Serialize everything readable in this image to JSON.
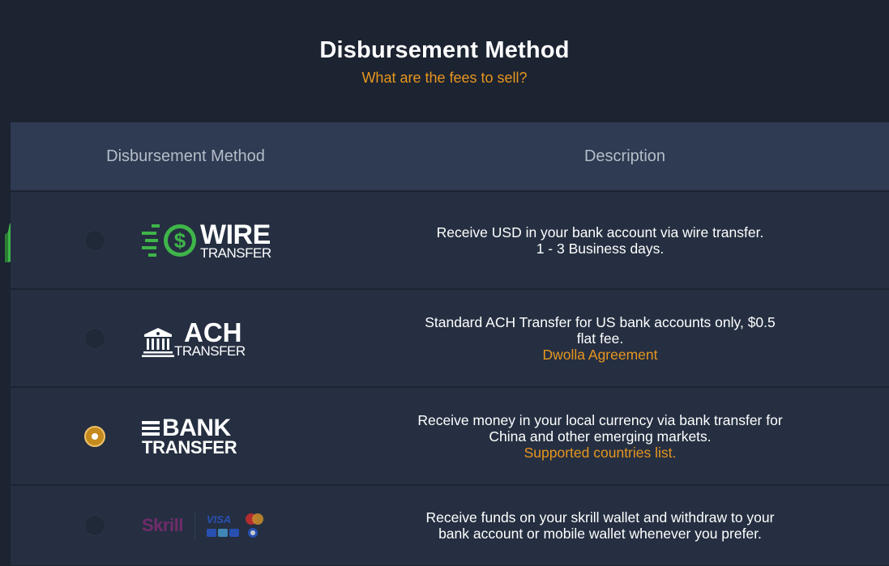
{
  "header": {
    "title": "Disbursement Method",
    "fees_link": "What are the fees to sell?"
  },
  "table": {
    "columns": [
      "Disbursement Method",
      "Description"
    ],
    "rows": [
      {
        "method": "wire",
        "logo_big": "WIRE",
        "logo_small": "TRANSFER",
        "selected": false,
        "recommended": true,
        "desc_lines": [
          "Receive USD in your bank account via wire transfer.",
          "1 - 3 Business days."
        ],
        "link": ""
      },
      {
        "method": "ach",
        "logo_big": "ACH",
        "logo_small": "TRANSFER",
        "selected": false,
        "desc_lines": [
          "Standard ACH Transfer for US bank accounts only, $0.5",
          "flat fee."
        ],
        "link": "Dwolla Agreement"
      },
      {
        "method": "bank",
        "logo_big": "BANK",
        "logo_small": "TRANSFER",
        "selected": true,
        "desc_lines": [
          "Receive money in your local currency via bank transfer for",
          "China and other emerging markets."
        ],
        "link": "Supported countries list."
      },
      {
        "method": "skrill",
        "logo_big": "Skrill",
        "selected": false,
        "desc_lines": [
          "Receive funds on your skrill wallet and withdraw to your",
          "bank account or mobile wallet whenever you prefer."
        ],
        "link": "",
        "card_visa": "VISA"
      }
    ]
  },
  "colors": {
    "background": "#1c2331",
    "header_row": "#2e3b52",
    "row": "#252f41",
    "accent": "#e8961e",
    "wire_green": "#3fb54a",
    "badge_green": "#3fb54a"
  }
}
